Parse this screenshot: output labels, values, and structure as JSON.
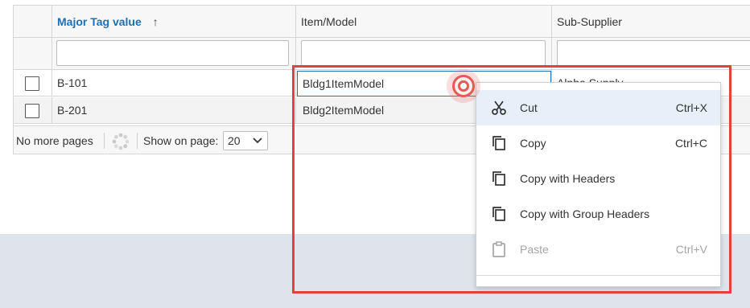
{
  "grid": {
    "columns": [
      {
        "label": "Major Tag value",
        "sort_icon": "arrow-up-icon",
        "sort_glyph": "↑"
      },
      {
        "label": "Item/Model"
      },
      {
        "label": "Sub-Supplier"
      }
    ],
    "filters": [
      "",
      "",
      ""
    ],
    "rows": [
      {
        "tag": "B-101",
        "model": "Bldg1ItemModel",
        "supplier": "Alpha Supply"
      },
      {
        "tag": "B-201",
        "model": "Bldg2ItemModel",
        "supplier": ""
      }
    ]
  },
  "pager": {
    "status": "No more pages",
    "loader_icon": "spinner-icon",
    "show_label": "Show on page:",
    "page_size": "20"
  },
  "context_menu": {
    "items": [
      {
        "label": "Cut",
        "shortcut": "Ctrl+X",
        "icon": "scissors-icon",
        "enabled": true
      },
      {
        "label": "Copy",
        "shortcut": "Ctrl+C",
        "icon": "copy-icon",
        "enabled": true
      },
      {
        "label": "Copy with Headers",
        "shortcut": "",
        "icon": "copy-icon",
        "enabled": true
      },
      {
        "label": "Copy with Group Headers",
        "shortcut": "",
        "icon": "copy-icon",
        "enabled": true
      },
      {
        "label": "Paste",
        "shortcut": "Ctrl+V",
        "icon": "clipboard-icon",
        "enabled": false
      }
    ]
  },
  "colors": {
    "accent": "#1f6fb4",
    "highlight": "#e3413d",
    "menu_hover": "#e7eff8",
    "bottom_band": "#dfe3ec"
  }
}
